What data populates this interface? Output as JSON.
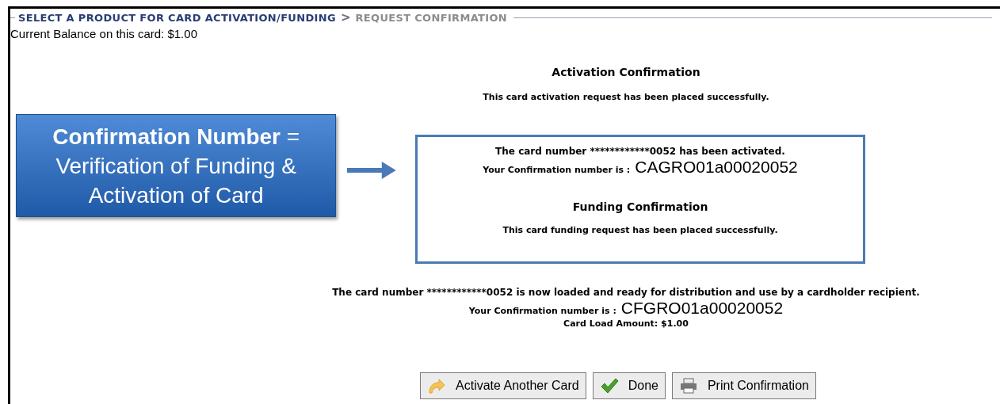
{
  "breadcrumb": {
    "items": [
      {
        "label": "SELECT A PRODUCT FOR CARD ACTIVATION/FUNDING",
        "selected": false
      },
      {
        "label": "REQUEST CONFIRMATION",
        "selected": true
      }
    ],
    "separator": ">"
  },
  "balance": "Current Balance on this card: $1.00",
  "activation": {
    "title": "Activation Confirmation",
    "message": "This card activation request has been placed successfully."
  },
  "callout": {
    "text": "**Confirmation Number** = Verification of Funding & Activation of Card"
  },
  "highlight_box": {
    "card_line": "The card number ************0052 has been activated.",
    "confirmation_label": "Your Confirmation number is :",
    "confirmation_number": "CAGRO01a00020052",
    "funding_title": "Funding Confirmation",
    "funding_message": "This card funding request has been placed successfully."
  },
  "load": {
    "card_line": "The card number ************0052 is now loaded and ready for distribution and use by a cardholder recipient.",
    "confirmation_label": "Your Confirmation number is :",
    "confirmation_number": "CFGRO01a00020052",
    "amount": "Card Load Amount: $1.00"
  },
  "buttons": [
    {
      "kind": "redo",
      "label": "Activate Another Card"
    },
    {
      "kind": "check",
      "label": "Done"
    },
    {
      "kind": "print",
      "label": "Print Confirmation"
    }
  ]
}
